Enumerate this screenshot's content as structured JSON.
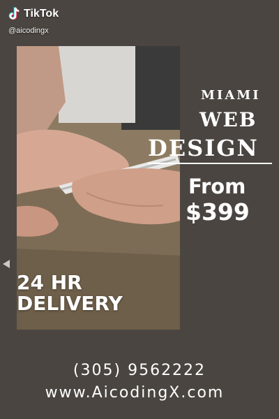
{
  "watermark": {
    "brand": "TikTok",
    "handle": "@aicodingx",
    "icon": "tiktok-note-icon"
  },
  "headline": {
    "line1": "MIAMI",
    "line2": "WEB",
    "line3": "DESIGN"
  },
  "offer": {
    "from": "From",
    "price": "$399"
  },
  "delivery": {
    "line1": "24 HR",
    "line2": "DELIVERY"
  },
  "contact": {
    "phone": "(305) 9562222",
    "website": "www.AicodingX.com"
  },
  "colors": {
    "background": "#4a4540",
    "text": "#ffffff"
  }
}
